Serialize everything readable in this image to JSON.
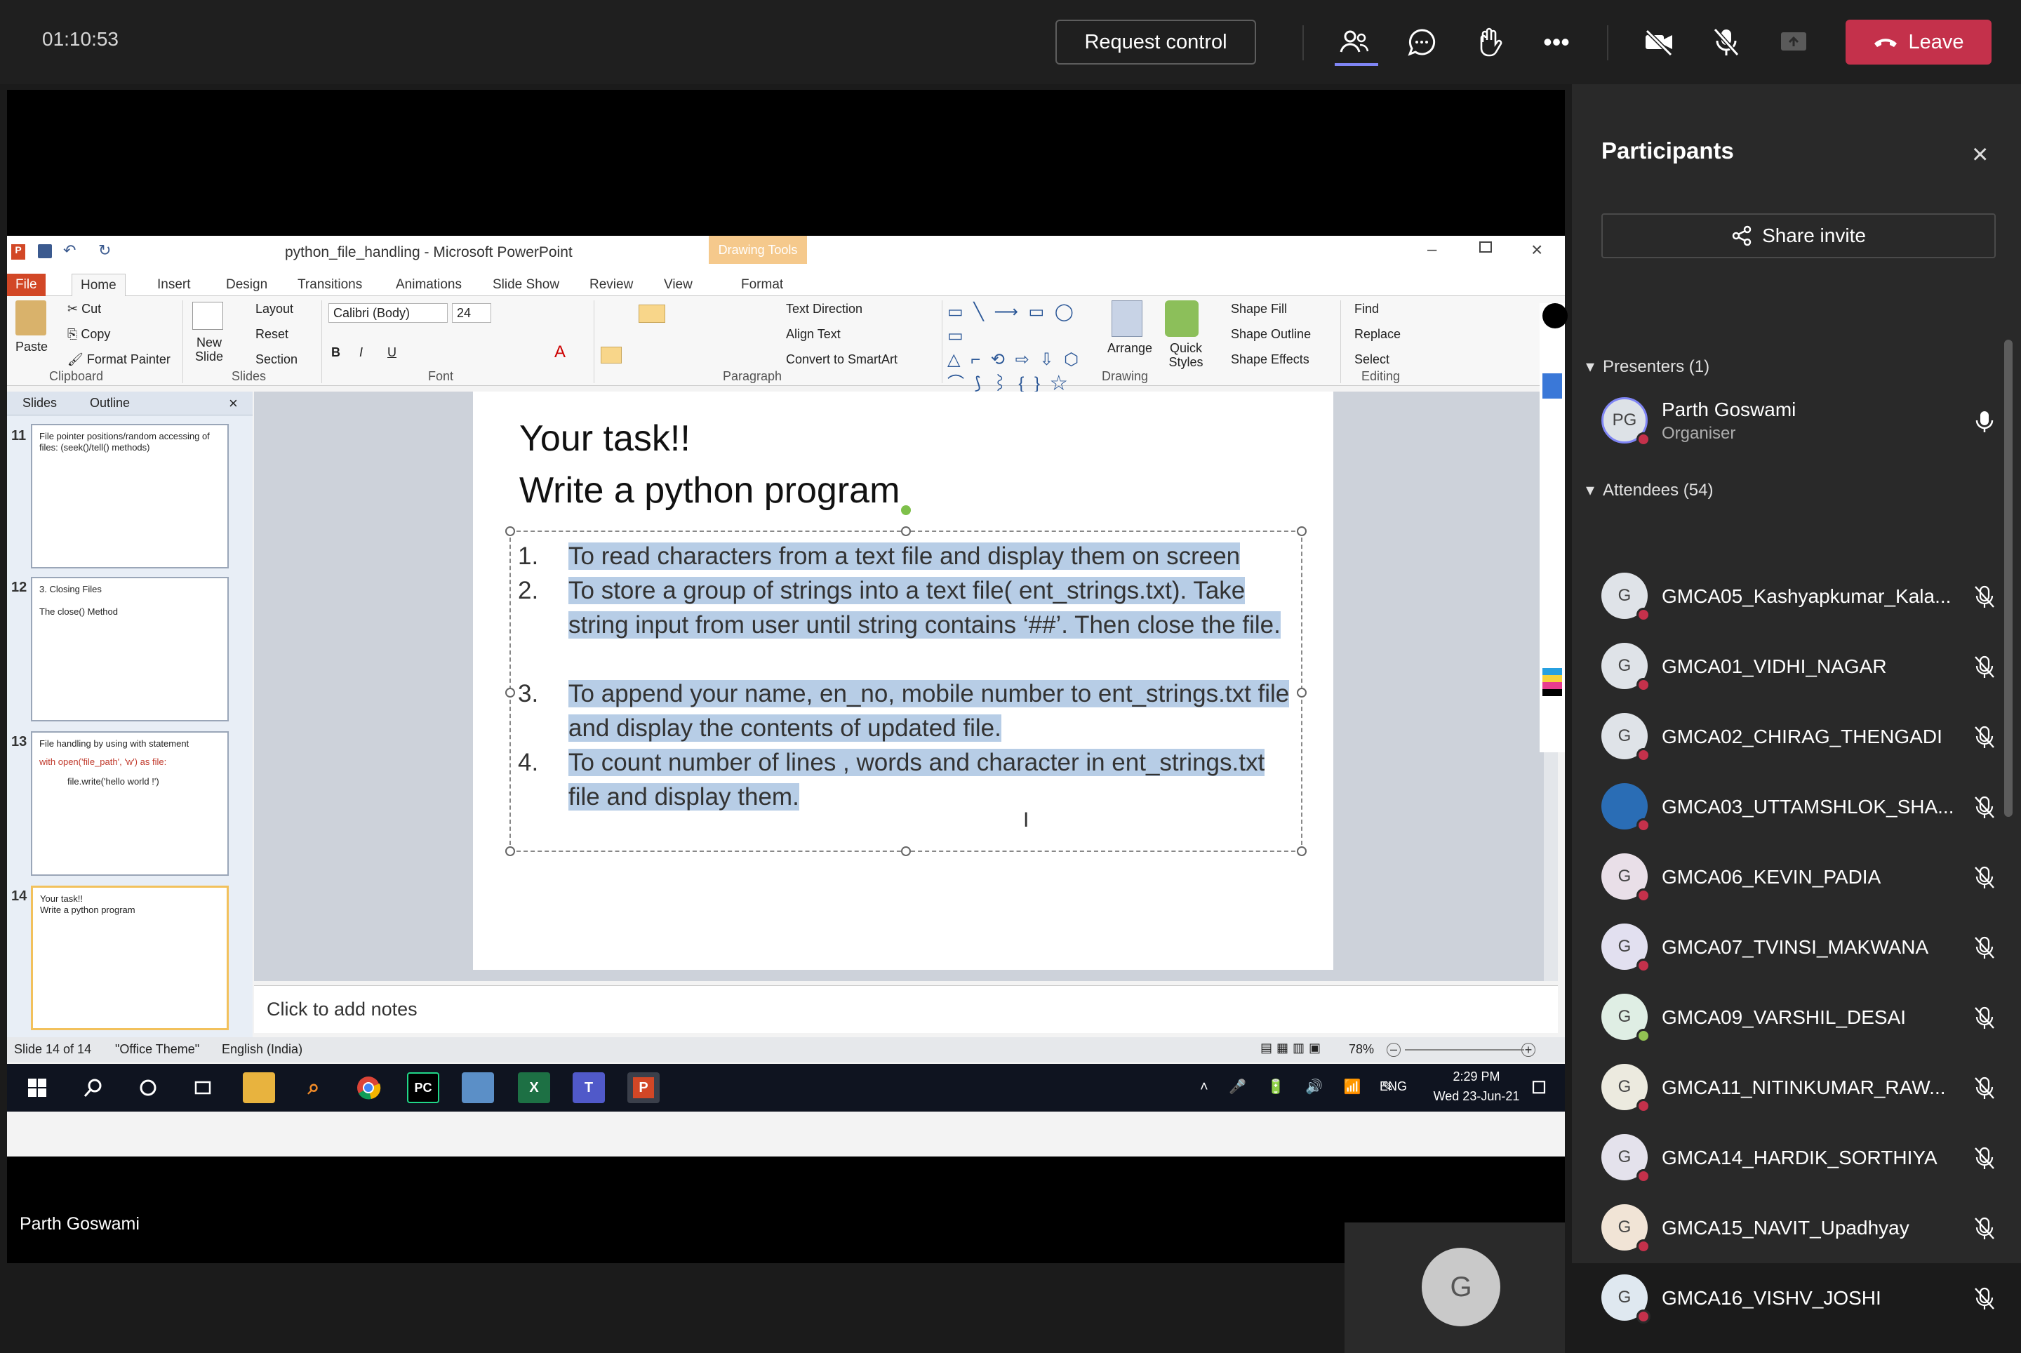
{
  "meeting": {
    "timer": "01:10:53",
    "request_control": "Request control",
    "leave": "Leave"
  },
  "powerpoint": {
    "window_title": "python_file_handling - Microsoft PowerPoint",
    "drawing_tools": "Drawing Tools",
    "tabs": [
      "File",
      "Home",
      "Insert",
      "Design",
      "Transitions",
      "Animations",
      "Slide Show",
      "Review",
      "View",
      "Format"
    ],
    "ribbon": {
      "paste": "Paste",
      "cut": "Cut",
      "copy": "Copy",
      "format_painter": "Format Painter",
      "clipboard": "Clipboard",
      "new_slide": "New Slide",
      "layout": "Layout",
      "reset": "Reset",
      "section": "Section",
      "slides": "Slides",
      "font_name": "Calibri (Body)",
      "font_size": "24",
      "font": "Font",
      "text_direction": "Text Direction",
      "align_text": "Align Text",
      "convert_smartart": "Convert to SmartArt",
      "paragraph": "Paragraph",
      "arrange": "Arrange",
      "quick_styles": "Quick Styles",
      "shape_fill": "Shape Fill",
      "shape_outline": "Shape Outline",
      "shape_effects": "Shape Effects",
      "drawing": "Drawing",
      "find": "Find",
      "replace": "Replace",
      "select": "Select",
      "editing": "Editing"
    },
    "pane_tabs": [
      "Slides",
      "Outline"
    ],
    "thumbnails": [
      {
        "num": "11",
        "title": "File pointer positions/random accessing of files: (seek()/tell() methods)"
      },
      {
        "num": "12",
        "title": "3. Closing Files",
        "sub": "The close() Method"
      },
      {
        "num": "13",
        "title": "File handling by using with statement",
        "sub": "with open('file_path', 'w') as file:",
        "code": "file.write('hello world !')"
      },
      {
        "num": "14",
        "title": "Your task!!",
        "sub": "Write a python program"
      }
    ],
    "slide": {
      "title1": "Your task!!",
      "title2": "Write a python program",
      "items": [
        {
          "n": "1.",
          "text": "To read characters from a text file and display them on screen"
        },
        {
          "n": "2.",
          "text": "To store a group of strings into a text file( ent_strings.txt). Take string input from user until string contains ‘##’. Then close the file."
        },
        {
          "n": "3.",
          "text": "To append your name, en_no, mobile number to ent_strings.txt file and display the contents of  updated file."
        },
        {
          "n": "4.",
          "text": "To count number of lines , words and character in ent_strings.txt file and display them."
        }
      ]
    },
    "notes": "Click to add notes",
    "status": {
      "slide": "Slide 14 of 14",
      "theme": "\"Office Theme\"",
      "language": "English (India)",
      "zoom": "78%"
    },
    "taskbar": {
      "lang": "ENG",
      "time": "2:29 PM",
      "date": "Wed 23-Jun-21"
    }
  },
  "video_label": "Parth Goswami",
  "g_tile": "G",
  "participants": {
    "title": "Participants",
    "share_invite": "Share invite",
    "presenters_header": "Presenters (1)",
    "presenter": {
      "initials": "PG",
      "name": "Parth Goswami",
      "role": "Organiser"
    },
    "attendees_header": "Attendees (54)",
    "attendees": [
      {
        "initial": "G",
        "name": "GMCA05_Kashyapkumar_Kala..."
      },
      {
        "initial": "G",
        "name": "GMCA01_VIDHI_NAGAR"
      },
      {
        "initial": "G",
        "name": "GMCA02_CHIRAG_THENGADI"
      },
      {
        "initial": "",
        "name": "GMCA03_UTTAMSHLOK_SHA..."
      },
      {
        "initial": "G",
        "name": "GMCA06_KEVIN_PADIA"
      },
      {
        "initial": "G",
        "name": "GMCA07_TVINSI_MAKWANA"
      },
      {
        "initial": "G",
        "name": "GMCA09_VARSHIL_DESAI"
      },
      {
        "initial": "G",
        "name": "GMCA11_NITINKUMAR_RAW..."
      },
      {
        "initial": "G",
        "name": "GMCA14_HARDIK_SORTHIYA"
      },
      {
        "initial": "G",
        "name": "GMCA15_NAVIT_Upadhyay"
      },
      {
        "initial": "G",
        "name": "GMCA16_VISHV_JOSHI"
      }
    ]
  },
  "colors": {
    "leave": "#c4314b",
    "highlight": "#b7cde6",
    "panel": "#292929",
    "accent": "#6264a7"
  }
}
